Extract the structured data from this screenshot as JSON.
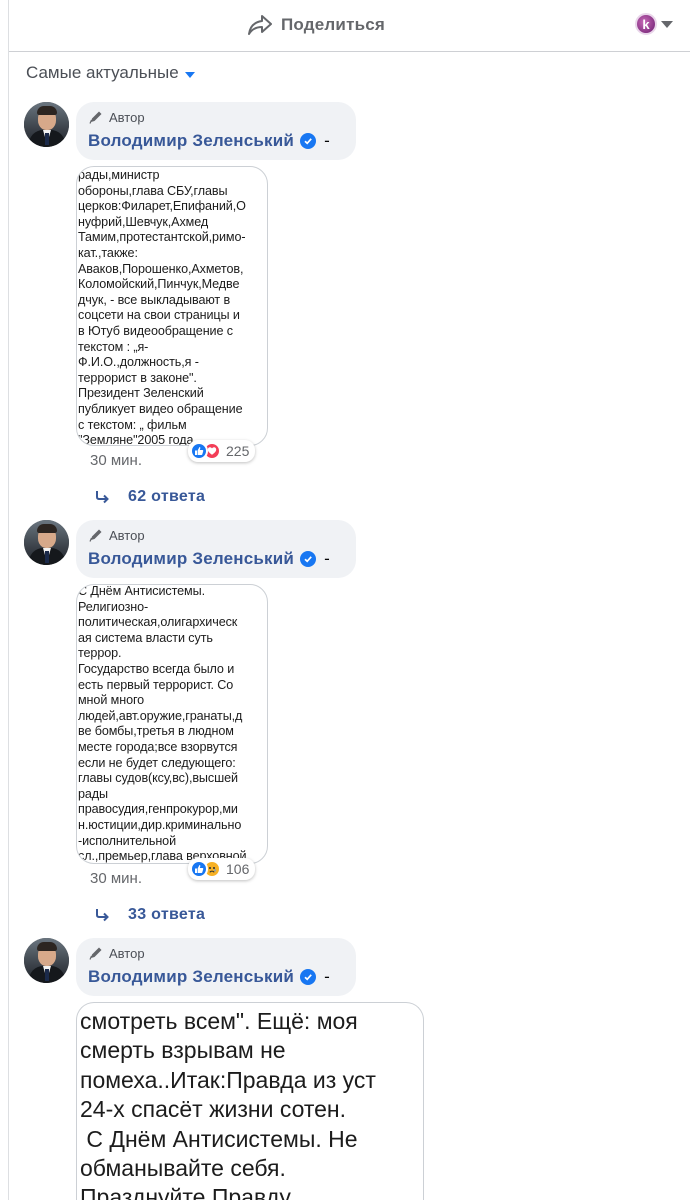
{
  "share_bar": {
    "share_label": "Поделиться",
    "actor_initial": "k"
  },
  "sort": {
    "label": "Самые актуальные"
  },
  "comments": [
    {
      "author_tag": "Автор",
      "author_name": "Володимир Зеленський",
      "separator": "-",
      "attachment_lines": "рады,министр\nобороны,глава СБУ,главы\nцерков:Филарет,Епифаний,О\nнуфрий,Шевчук,Ахмед\nТамим,протестантской,римо-\nкат.,также:\nАваков,Порошенко,Ахметов,\nКоломойский,Пинчук,Медве\nдчук, - все выкладывают в\nсоцсети на свои страницы и\nв Ютуб видеообращение с\nтекстом : „я-\nФ.И.О.,должность,я -\nтеррорист в законе\".\nПрезидент Зеленский\nпубликует видео обращение\nс текстом: „ фильм\n\"Земляне\"2005 года",
      "reaction_count": "225",
      "reactions": [
        "like",
        "love"
      ],
      "time": "30 мин.",
      "replies_label": "62 ответа"
    },
    {
      "author_tag": "Автор",
      "author_name": "Володимир Зеленський",
      "separator": "-",
      "attachment_lines": "С Днём Антисистемы.\nРелигиозно-\nполитическая,олигархическ\nая система власти суть\nтеррор.\nГосударство всегда было и\nесть первый террорист. Со\nмной много\nлюдей,авт.оружие,гранаты,д\nве бомбы,третья в людном\nместе города;все взорвутся\nесли не будет следующего:\nглавы судов(ксу,вс),высшей\nрады\nправосудия,генпрокурор,ми\nн.юстиции,дир.криминально\n-исполнительной\nсл.,премьер,глава верховной",
      "reaction_count": "106",
      "reactions": [
        "like",
        "sad"
      ],
      "time": "30 мин.",
      "replies_label": "33 ответа"
    },
    {
      "author_tag": "Автор",
      "author_name": "Володимир Зеленський",
      "separator": "-",
      "attachment_lines": "смотреть всем\". Ещё: моя\nсмерть взрывам не\nпомеха..Итак:Правда из уст\n24-х спасёт жизни сотен.\n С Днём Антисистемы. Не\nобманывайте себя.\nПразднуйте Правду"
    }
  ],
  "colors": {
    "link": "#385898",
    "accent": "#1877f2",
    "bubble": "#f0f2f5",
    "meta": "#65676b"
  },
  "icons": [
    "share-icon",
    "caret-down-icon",
    "pencil-icon",
    "verified-icon",
    "reply-arrow-icon",
    "like-icon",
    "love-icon",
    "sad-icon"
  ]
}
